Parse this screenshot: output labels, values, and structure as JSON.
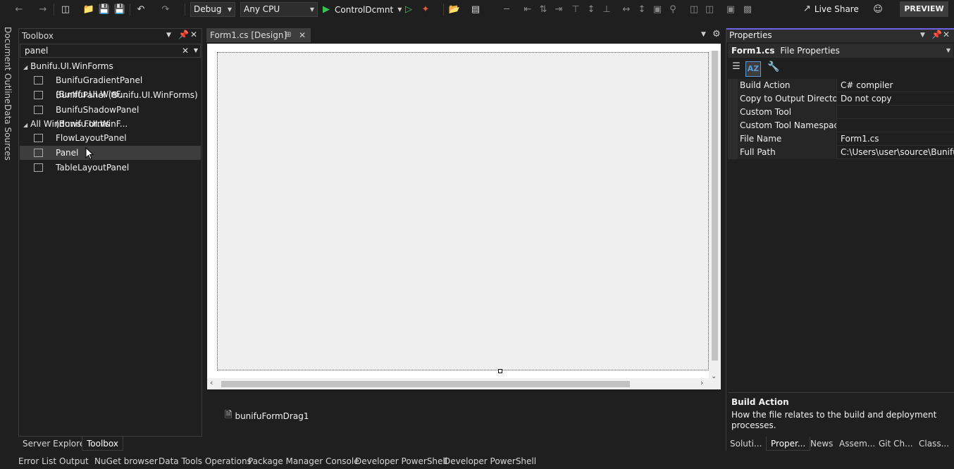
{
  "toolbar": {
    "configuration": "Debug",
    "platform": "Any CPU",
    "startup_project": "ControlDcmnt",
    "live_share": "Live Share",
    "preview": "PREVIEW"
  },
  "left_strip": {
    "document_outline": "Document Outline",
    "data_sources": "Data Sources"
  },
  "toolbox": {
    "title": "Toolbox",
    "search_value": "panel",
    "categories": [
      {
        "label": "Bunifu.UI.WinForms",
        "items": [
          {
            "label": "BunifuGradientPanel (Bunifu.UI.WinF..."
          },
          {
            "label": "BunifuPanel (Bunifu.UI.WinForms)"
          },
          {
            "label": "BunifuShadowPanel (Bunifu.UI.WinF..."
          }
        ]
      },
      {
        "label": "All Windows Forms",
        "items": [
          {
            "label": "FlowLayoutPanel"
          },
          {
            "label": "Panel"
          },
          {
            "label": "TableLayoutPanel"
          }
        ]
      }
    ],
    "bottom_tabs": [
      "Server Explorer",
      "Toolbox"
    ]
  },
  "designer": {
    "tab_label": "Form1.cs [Design]",
    "tray_component": "bunifuFormDrag1"
  },
  "properties": {
    "title": "Properties",
    "object_name": "Form1.cs",
    "object_type": "File Properties",
    "rows": [
      {
        "name": "Build Action",
        "value": "C# compiler"
      },
      {
        "name": "Copy to Output Directory",
        "value": "Do not copy"
      },
      {
        "name": "Custom Tool",
        "value": ""
      },
      {
        "name": "Custom Tool Namespace",
        "value": ""
      },
      {
        "name": "File Name",
        "value": "Form1.cs"
      },
      {
        "name": "Full Path",
        "value": "C:\\Users\\user\\source\\Bunifu\\re"
      }
    ],
    "description_title": "Build Action",
    "description_text": "How the file relates to the build and deployment processes.",
    "bottom_tabs": [
      "Soluti...",
      "Proper...",
      "News",
      "Assem...",
      "Git Ch...",
      "Class..."
    ]
  },
  "status_tabs": [
    "Error List",
    "Output",
    "NuGet browser",
    "Data Tools Operations",
    "Package Manager Console",
    "Developer PowerShell",
    "Developer PowerShell"
  ],
  "colors": {
    "accent": "#7160e8",
    "play_green": "#3ec24e",
    "hot_reload": "#e05a47"
  }
}
